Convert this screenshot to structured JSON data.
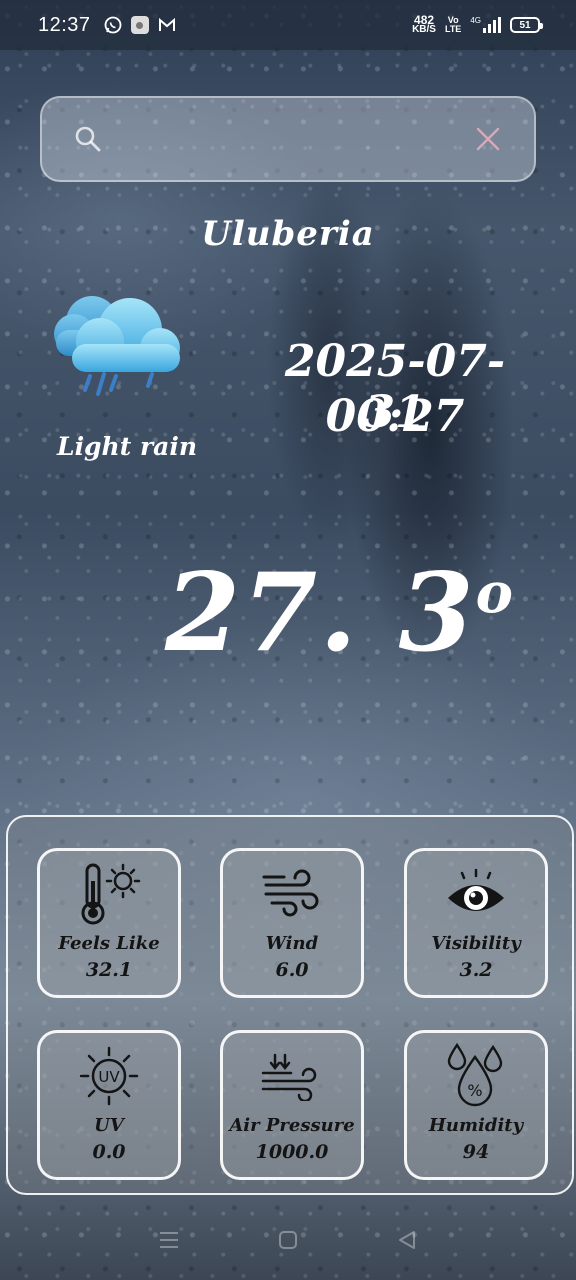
{
  "status_bar": {
    "time": "12:37",
    "net_speed_value": "482",
    "net_speed_unit": "KB/S",
    "volte_top": "Vo",
    "volte_bottom": "LTE",
    "network_type": "4G",
    "battery": "51",
    "left_icons": [
      "whatsapp-icon",
      "app-icon",
      "gmail-icon"
    ]
  },
  "search": {
    "value": "",
    "placeholder": ""
  },
  "location": {
    "city": "Uluberia"
  },
  "current": {
    "condition": "Light rain",
    "condition_icon": "cloud-rain-icon",
    "date": "2025-07-31",
    "time": "00:27",
    "temperature": "27. 3",
    "degree_symbol": "o"
  },
  "details": [
    {
      "label": "Feels Like",
      "value": "32.1",
      "icon": "thermometer-sun-icon"
    },
    {
      "label": "Wind",
      "value": "6.0",
      "icon": "wind-icon"
    },
    {
      "label": "Visibility",
      "value": "3.2",
      "icon": "eye-icon"
    },
    {
      "label": "UV",
      "value": "0.0",
      "icon": "uv-sun-icon"
    },
    {
      "label": "Air Pressure",
      "value": "1000.0",
      "icon": "air-pressure-icon"
    },
    {
      "label": "Humidity",
      "value": "94",
      "icon": "humidity-drops-icon"
    }
  ],
  "colors": {
    "cloud_light": "#8fd8f5",
    "cloud_dark": "#3ba3dc",
    "rain": "#3a7fc8",
    "card_text": "#141414"
  }
}
